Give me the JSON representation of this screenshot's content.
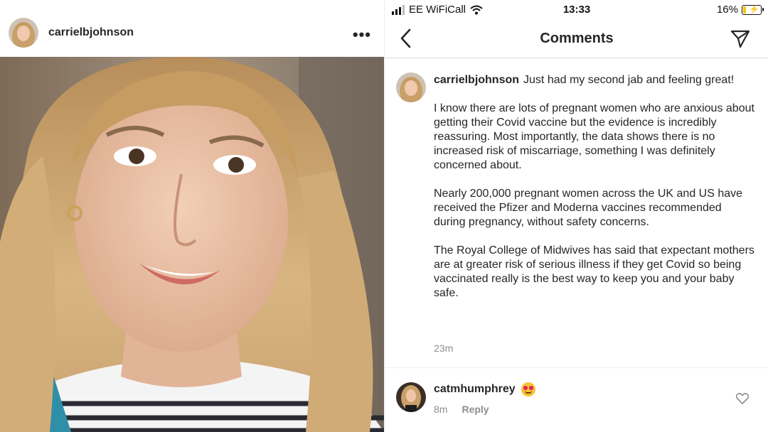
{
  "post": {
    "username": "carrielbjohnson",
    "more_icon": "more-horizontal-icon"
  },
  "statusbar": {
    "carrier": "EE WiFiCall",
    "time": "13:33",
    "battery": "16%",
    "battery_level": 0.16
  },
  "nav": {
    "title": "Comments",
    "back_icon": "chevron-left-icon",
    "send_icon": "paper-plane-icon"
  },
  "caption": {
    "username": "carrielbjohnson",
    "first_line": "Just had my second jab and feeling great!",
    "paragraphs": [
      "I know there are lots of pregnant women who are anxious about getting their Covid vaccine but the evidence is incredibly reassuring. Most importantly, the data shows there is no increased risk of miscarriage, something I was definitely concerned about.",
      "Nearly 200,000 pregnant women across the UK and US have received the Pfizer and Moderna vaccines recommended during pregnancy, without safety concerns.",
      "The Royal College of Midwives has said that expectant mothers are at greater risk of serious illness if they get Covid so being vaccinated really is the best way to keep you and your baby safe."
    ],
    "time": "23m"
  },
  "comment": {
    "username": "catmhumphrey",
    "emoji_icon": "heart-eyes-emoji-icon",
    "time": "8m",
    "reply_label": "Reply",
    "like_icon": "heart-outline-icon"
  }
}
